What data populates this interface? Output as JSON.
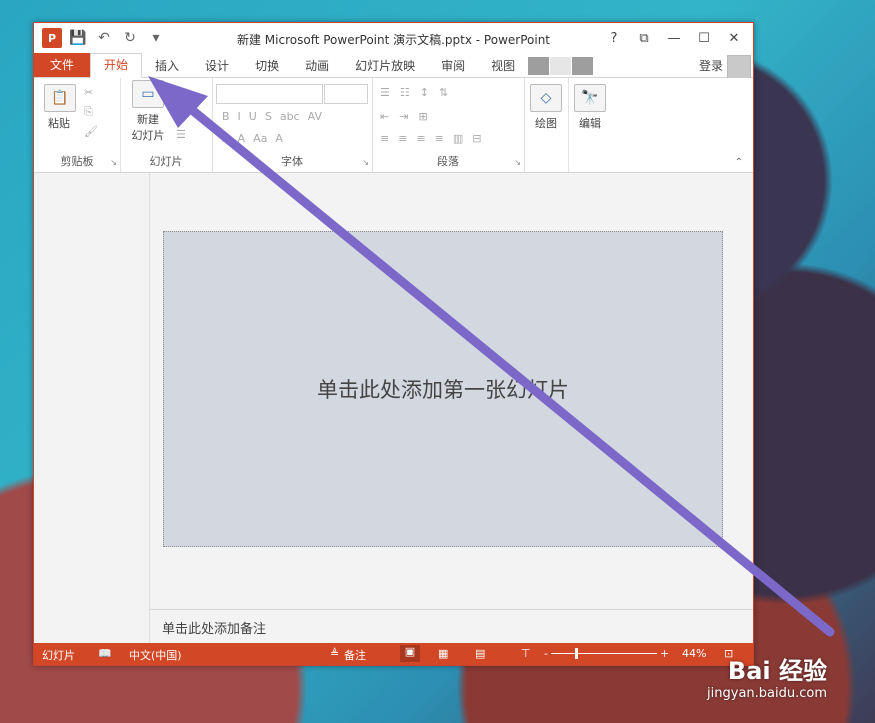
{
  "window": {
    "title": "新建 Microsoft PowerPoint 演示文稿.pptx - PowerPoint",
    "logo": "P",
    "controls": [
      "?",
      "⧉",
      "—",
      "☐",
      "✕"
    ]
  },
  "qat": {
    "save_icon": "💾",
    "undo_icon": "↶",
    "redo_icon": "↻",
    "customize_icon": "▾"
  },
  "tabs": [
    "文件",
    "开始",
    "插入",
    "设计",
    "切换",
    "动画",
    "幻灯片放映",
    "审阅",
    "视图"
  ],
  "login": "登录",
  "ribbon": {
    "groups": [
      "剪贴板",
      "幻灯片",
      "字体",
      "段落"
    ],
    "paste": "粘贴",
    "new_slide_line1": "新建",
    "new_slide_line2": "幻灯片",
    "draw": "绘图",
    "edit": "编辑",
    "font_buttons": [
      "B",
      "I",
      "U",
      "S",
      "abc",
      "AV",
      "A",
      "A",
      "Aa",
      "A"
    ]
  },
  "slide": {
    "placeholder": "单击此处添加第一张幻灯片"
  },
  "notes": {
    "placeholder": "单击此处添加备注"
  },
  "status": {
    "slides": "幻灯片",
    "language": "中文(中国)",
    "notes_btn": "备注",
    "zoom_minus": "-",
    "zoom_plus": "+",
    "zoom": "44%"
  },
  "watermark": {
    "brand": "Bai 经验",
    "url": "jingyan.baidu.com"
  },
  "colors": {
    "accent": "#d24726",
    "arrow": "#7b68c8"
  }
}
